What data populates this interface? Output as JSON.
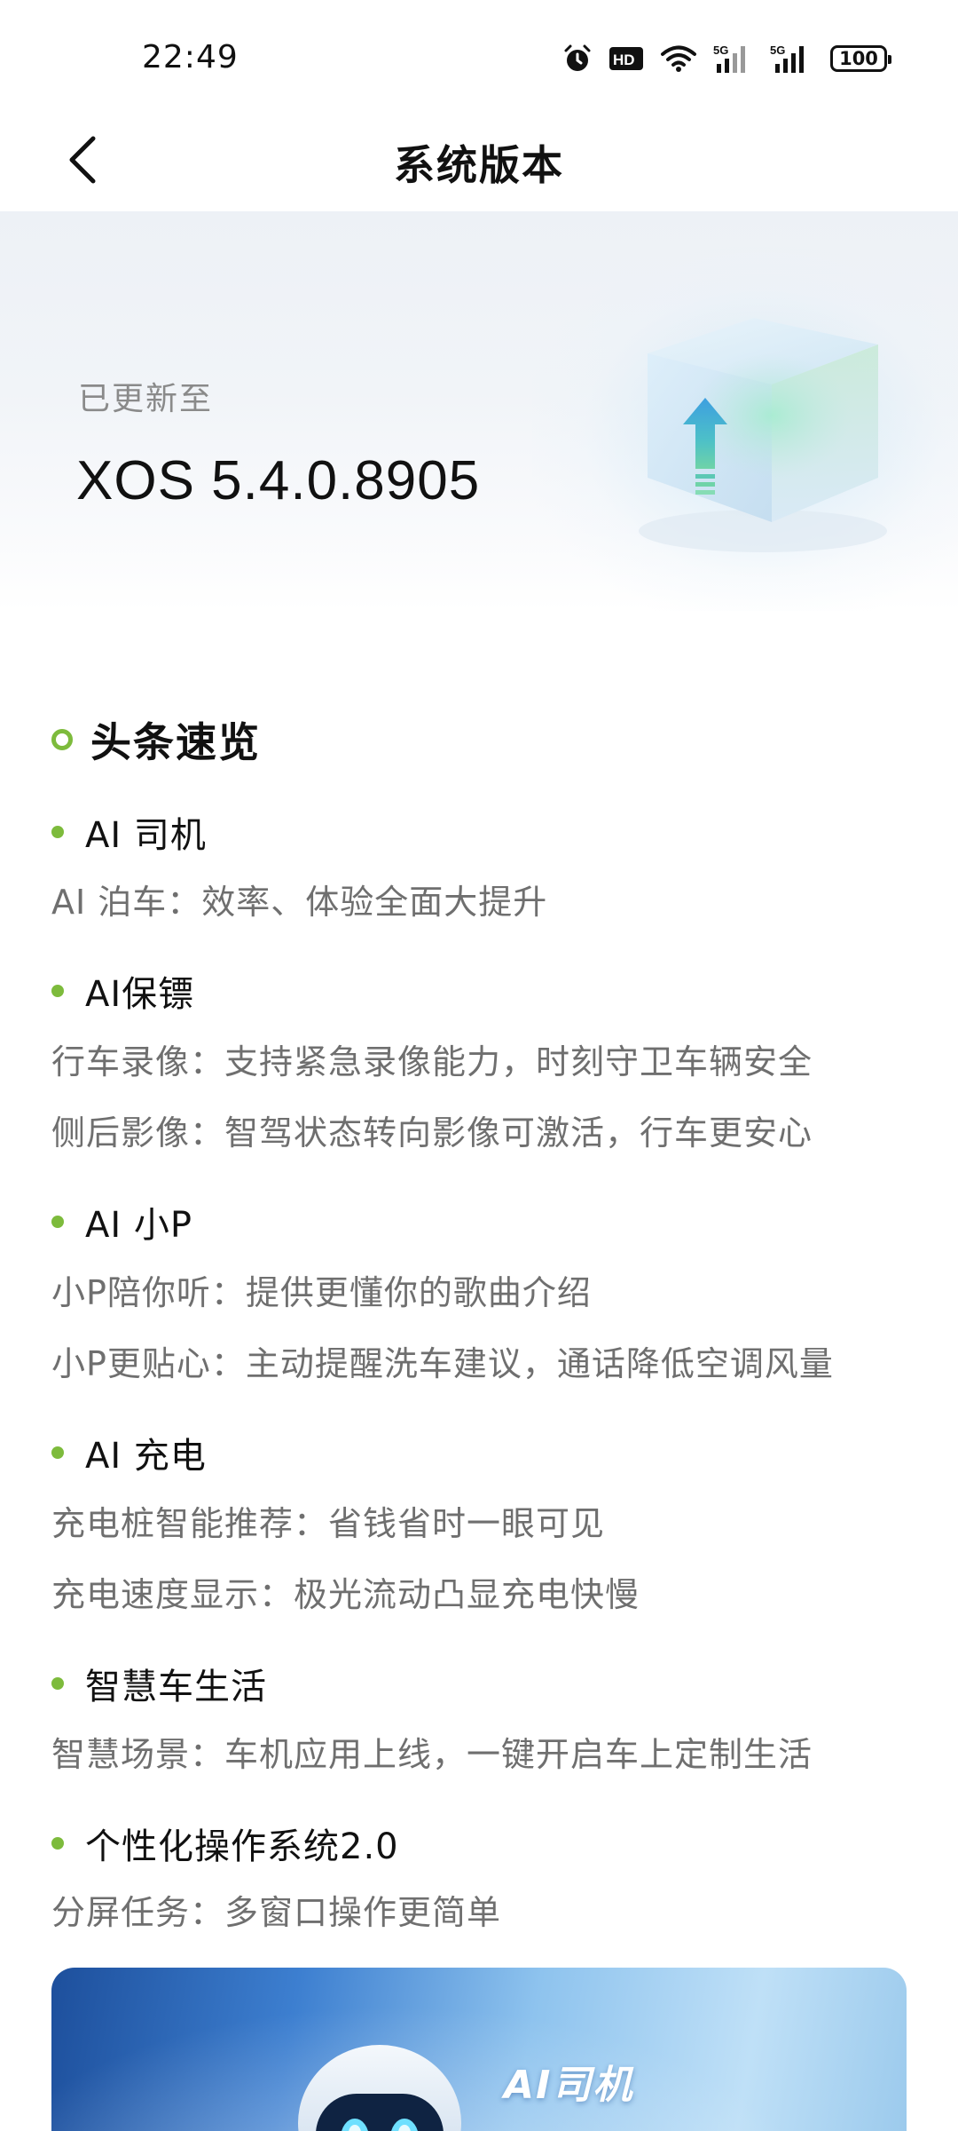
{
  "status_bar": {
    "time": "22:49",
    "battery": "100",
    "hd_label": "HD",
    "signal_label_1": "5G",
    "signal_label_2": "5G"
  },
  "header": {
    "title": "系统版本"
  },
  "hero": {
    "label": "已更新至",
    "version": "XOS 5.4.0.8905"
  },
  "section": {
    "title": "头条速览"
  },
  "features": [
    {
      "title": "AI 司机",
      "items": [
        "AI 泊车：效率、体验全面大提升"
      ]
    },
    {
      "title": "AI保镖",
      "items": [
        "行车录像：支持紧急录像能力，时刻守卫车辆安全",
        "侧后影像：智驾状态转向影像可激活，行车更安心"
      ]
    },
    {
      "title": "AI 小P",
      "items": [
        "小P陪你听：提供更懂你的歌曲介绍",
        "小P更贴心：主动提醒洗车建议，通话降低空调风量"
      ]
    },
    {
      "title": "AI 充电",
      "items": [
        "充电桩智能推荐：省钱省时一眼可见",
        "充电速度显示：极光流动凸显充电快慢"
      ]
    },
    {
      "title": "智慧车生活",
      "items": [
        "智慧场景：车机应用上线，一键开启车上定制生活"
      ]
    },
    {
      "title": "个性化操作系统2.0",
      "items": [
        "分屏任务：多窗口操作更简单"
      ]
    }
  ],
  "banner": {
    "title": "AI司机"
  },
  "colors": {
    "accent_green": "#7dbb3c",
    "banner_blue": "#3d7fd0"
  }
}
